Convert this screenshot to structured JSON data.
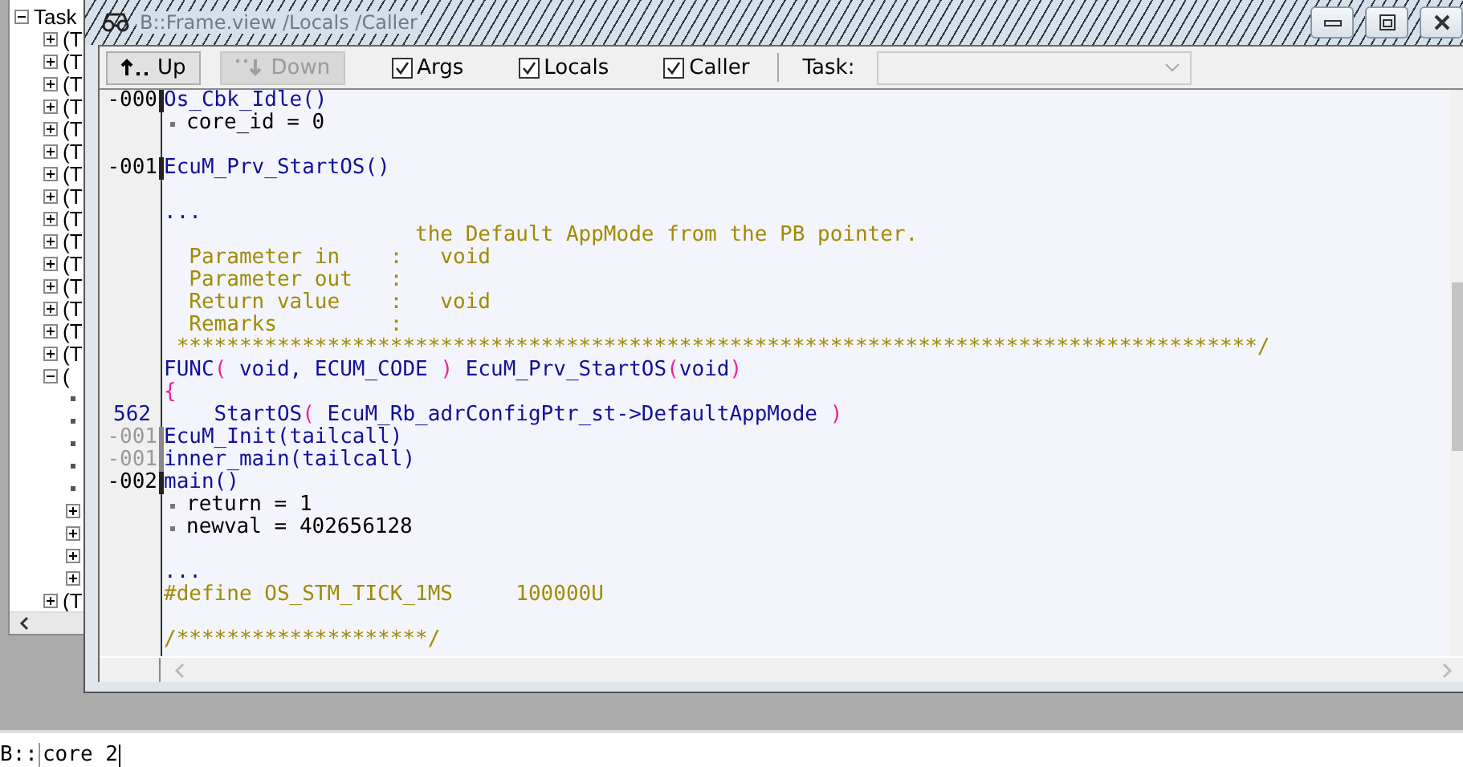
{
  "tree": {
    "label": "Task",
    "expanded": true,
    "children": [
      {
        "kind": "node",
        "label": "(T",
        "expanded": false
      },
      {
        "kind": "node",
        "label": "(T",
        "expanded": false
      },
      {
        "kind": "node",
        "label": "(T",
        "expanded": false
      },
      {
        "kind": "node",
        "label": "(T",
        "expanded": false
      },
      {
        "kind": "node",
        "label": "(T",
        "expanded": false
      },
      {
        "kind": "node",
        "label": "(T",
        "expanded": false
      },
      {
        "kind": "node",
        "label": "(T",
        "expanded": false
      },
      {
        "kind": "node",
        "label": "(T",
        "expanded": false
      },
      {
        "kind": "node",
        "label": "(T",
        "expanded": false
      },
      {
        "kind": "node",
        "label": "(T",
        "expanded": false
      },
      {
        "kind": "node",
        "label": "(T",
        "expanded": false
      },
      {
        "kind": "node",
        "label": "(T",
        "expanded": false
      },
      {
        "kind": "node",
        "label": "(T",
        "expanded": false
      },
      {
        "kind": "node",
        "label": "(T",
        "expanded": false
      },
      {
        "kind": "node",
        "label": "(T",
        "expanded": false
      },
      {
        "kind": "node",
        "label": "(",
        "expanded": true,
        "children": [
          {
            "kind": "leaf"
          },
          {
            "kind": "leaf"
          },
          {
            "kind": "leaf"
          },
          {
            "kind": "leaf"
          },
          {
            "kind": "leaf"
          },
          {
            "kind": "node",
            "expanded": false
          },
          {
            "kind": "node",
            "expanded": false
          },
          {
            "kind": "node",
            "expanded": false
          },
          {
            "kind": "node",
            "expanded": false
          }
        ]
      },
      {
        "kind": "node",
        "label": "(T",
        "expanded": false
      }
    ]
  },
  "window": {
    "title": "B::Frame.view /Locals /Caller"
  },
  "toolbar": {
    "buttons": [
      {
        "label": "Up",
        "kind": "up",
        "disabled": false
      },
      {
        "label": "Down",
        "kind": "down",
        "disabled": true
      }
    ],
    "checkboxes": [
      {
        "label": "Args",
        "checked": true
      },
      {
        "label": "Locals",
        "checked": true
      },
      {
        "label": "Caller",
        "checked": true
      }
    ],
    "task": {
      "label": "Task:",
      "disabled": true
    }
  },
  "lines": [
    {
      "kind": "frame",
      "level": "-000",
      "tailcall": false,
      "segments": [
        {
          "kind": "name",
          "text": "Os_Cbk_Idle()"
        }
      ]
    },
    {
      "kind": "local",
      "text": "core_id = 0"
    },
    {
      "kind": "blank"
    },
    {
      "kind": "frame",
      "level": "-001",
      "tailcall": false,
      "segments": [
        {
          "kind": "name",
          "text": "EcuM_Prv_StartOS()"
        }
      ]
    },
    {
      "kind": "blank"
    },
    {
      "kind": "source",
      "segments": [
        {
          "kind": "name",
          "text": "..."
        }
      ]
    },
    {
      "kind": "source",
      "segments": [
        {
          "kind": "comment",
          "text": "                    the Default AppMode from the PB pointer."
        }
      ]
    },
    {
      "kind": "source",
      "segments": [
        {
          "kind": "comment",
          "text": "  Parameter in    :   void"
        }
      ]
    },
    {
      "kind": "source",
      "segments": [
        {
          "kind": "comment",
          "text": "  Parameter out   :"
        }
      ]
    },
    {
      "kind": "source",
      "segments": [
        {
          "kind": "comment",
          "text": "  Return value    :   void"
        }
      ]
    },
    {
      "kind": "source",
      "segments": [
        {
          "kind": "comment",
          "text": "  Remarks         :"
        }
      ]
    },
    {
      "kind": "source",
      "segments": [
        {
          "kind": "comment",
          "text": " **************************************************************************************/"
        }
      ]
    },
    {
      "kind": "source",
      "segments": [
        {
          "kind": "name",
          "text": "FUNC"
        },
        {
          "kind": "paren",
          "text": "("
        },
        {
          "kind": "name",
          "text": " void, ECUM_CODE "
        },
        {
          "kind": "paren",
          "text": ")"
        },
        {
          "kind": "name",
          "text": " EcuM_Prv_StartOS"
        },
        {
          "kind": "paren",
          "text": "("
        },
        {
          "kind": "name",
          "text": "void"
        },
        {
          "kind": "paren",
          "text": ")"
        }
      ]
    },
    {
      "kind": "source",
      "segments": [
        {
          "kind": "paren",
          "text": "{"
        }
      ]
    },
    {
      "kind": "source",
      "line": "562",
      "segments": [
        {
          "kind": "name",
          "text": "    StartOS"
        },
        {
          "kind": "paren",
          "text": "("
        },
        {
          "kind": "name",
          "text": " EcuM_Rb_adrConfigPtr_st->DefaultAppMode "
        },
        {
          "kind": "paren",
          "text": ")"
        }
      ]
    },
    {
      "kind": "frame",
      "level": "-001",
      "tailcall": true,
      "segments": [
        {
          "kind": "name",
          "text": "EcuM_Init(tailcall)"
        }
      ]
    },
    {
      "kind": "frame",
      "level": "-001",
      "tailcall": true,
      "segments": [
        {
          "kind": "name",
          "text": "inner_main(tailcall)"
        }
      ]
    },
    {
      "kind": "frame",
      "level": "-002",
      "tailcall": false,
      "segments": [
        {
          "kind": "name",
          "text": "main()"
        }
      ]
    },
    {
      "kind": "local",
      "text": "return = 1"
    },
    {
      "kind": "local",
      "text": "newval = 402656128"
    },
    {
      "kind": "blank"
    },
    {
      "kind": "source",
      "segments": [
        {
          "kind": "name",
          "text": "..."
        }
      ]
    },
    {
      "kind": "source",
      "segments": [
        {
          "kind": "comment",
          "text": "#define OS_STM_TICK_1MS     100000U"
        }
      ]
    },
    {
      "kind": "blank"
    },
    {
      "kind": "source",
      "segments": [
        {
          "kind": "comment",
          "text": "/********************/"
        }
      ]
    }
  ],
  "command": {
    "prompt": "B::",
    "value": "core 2"
  }
}
